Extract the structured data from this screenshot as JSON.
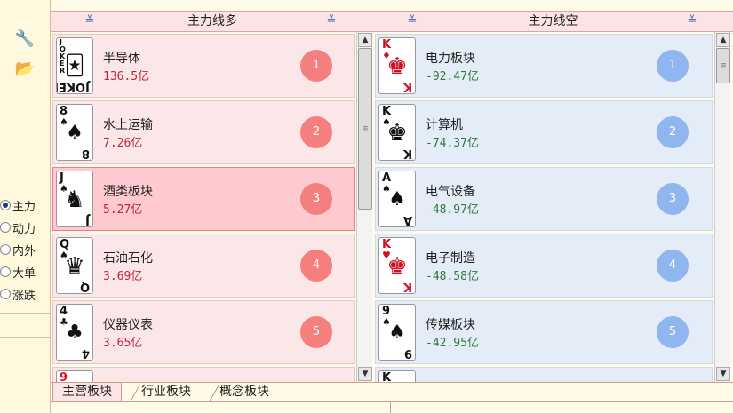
{
  "sidebar": {
    "tools": [
      {
        "icon": "wrench-icon",
        "glyph": "🔧"
      },
      {
        "icon": "folder-icon",
        "glyph": "📂"
      }
    ],
    "radios": [
      {
        "label": "主力",
        "checked": true
      },
      {
        "label": "动力",
        "checked": false
      },
      {
        "label": "内外",
        "checked": false
      },
      {
        "label": "大单",
        "checked": false
      },
      {
        "label": "涨跌",
        "checked": false
      }
    ]
  },
  "panels": {
    "left": {
      "title": "主力线多",
      "rows": [
        {
          "name": "半导体",
          "value": "136.5亿",
          "rank": "1",
          "card": {
            "rank": "JOKER",
            "suit": "",
            "color": "blk",
            "pip": "🃏",
            "type": "joker"
          }
        },
        {
          "name": "水上运输",
          "value": "7.26亿",
          "rank": "2",
          "card": {
            "rank": "8",
            "suit": "♠",
            "color": "blk",
            "pip": "♠",
            "type": "num"
          }
        },
        {
          "name": "酒类板块",
          "value": "5.27亿",
          "rank": "3",
          "card": {
            "rank": "J",
            "suit": "♠",
            "color": "blk",
            "pip": "♞",
            "type": "face"
          },
          "selected": true
        },
        {
          "name": "石油石化",
          "value": "3.69亿",
          "rank": "4",
          "card": {
            "rank": "Q",
            "suit": "♠",
            "color": "blk",
            "pip": "♛",
            "type": "face"
          }
        },
        {
          "name": "仪器仪表",
          "value": "3.65亿",
          "rank": "5",
          "card": {
            "rank": "4",
            "suit": "♣",
            "color": "blk",
            "pip": "♣",
            "type": "num"
          }
        },
        {
          "name": "",
          "value": "",
          "rank": "",
          "card": {
            "rank": "9",
            "suit": "♥",
            "color": "red",
            "pip": "",
            "type": "num"
          }
        }
      ]
    },
    "right": {
      "title": "主力线空",
      "rows": [
        {
          "name": "电力板块",
          "value": "-92.47亿",
          "rank": "1",
          "card": {
            "rank": "K",
            "suit": "♦",
            "color": "red",
            "pip": "♚",
            "type": "face"
          }
        },
        {
          "name": "计算机",
          "value": "-74.37亿",
          "rank": "2",
          "card": {
            "rank": "K",
            "suit": "♠",
            "color": "blk",
            "pip": "♚",
            "type": "face"
          }
        },
        {
          "name": "电气设备",
          "value": "-48.97亿",
          "rank": "3",
          "card": {
            "rank": "A",
            "suit": "♠",
            "color": "blk",
            "pip": "♠",
            "type": "ace"
          }
        },
        {
          "name": "电子制造",
          "value": "-48.58亿",
          "rank": "4",
          "card": {
            "rank": "K",
            "suit": "♥",
            "color": "red",
            "pip": "♚",
            "type": "face"
          }
        },
        {
          "name": "传媒板块",
          "value": "-42.95亿",
          "rank": "5",
          "card": {
            "rank": "9",
            "suit": "♠",
            "color": "blk",
            "pip": "♠",
            "type": "num"
          }
        },
        {
          "name": "",
          "value": "",
          "rank": "",
          "card": {
            "rank": "K",
            "suit": "",
            "color": "blk",
            "pip": "",
            "type": "num"
          }
        }
      ]
    }
  },
  "tabs": [
    {
      "label": "主营板块",
      "active": true
    },
    {
      "label": "行业板块",
      "active": false
    },
    {
      "label": "概念板块",
      "active": false
    }
  ],
  "icons": {
    "header_collapse": "≚",
    "scroll_up": "▲",
    "scroll_down": "▼",
    "grip": "≡"
  },
  "colors": {
    "up": "#c0243a",
    "down": "#2e7a3a",
    "rank_left": "#f57f7f",
    "rank_right": "#8fb6ee"
  }
}
